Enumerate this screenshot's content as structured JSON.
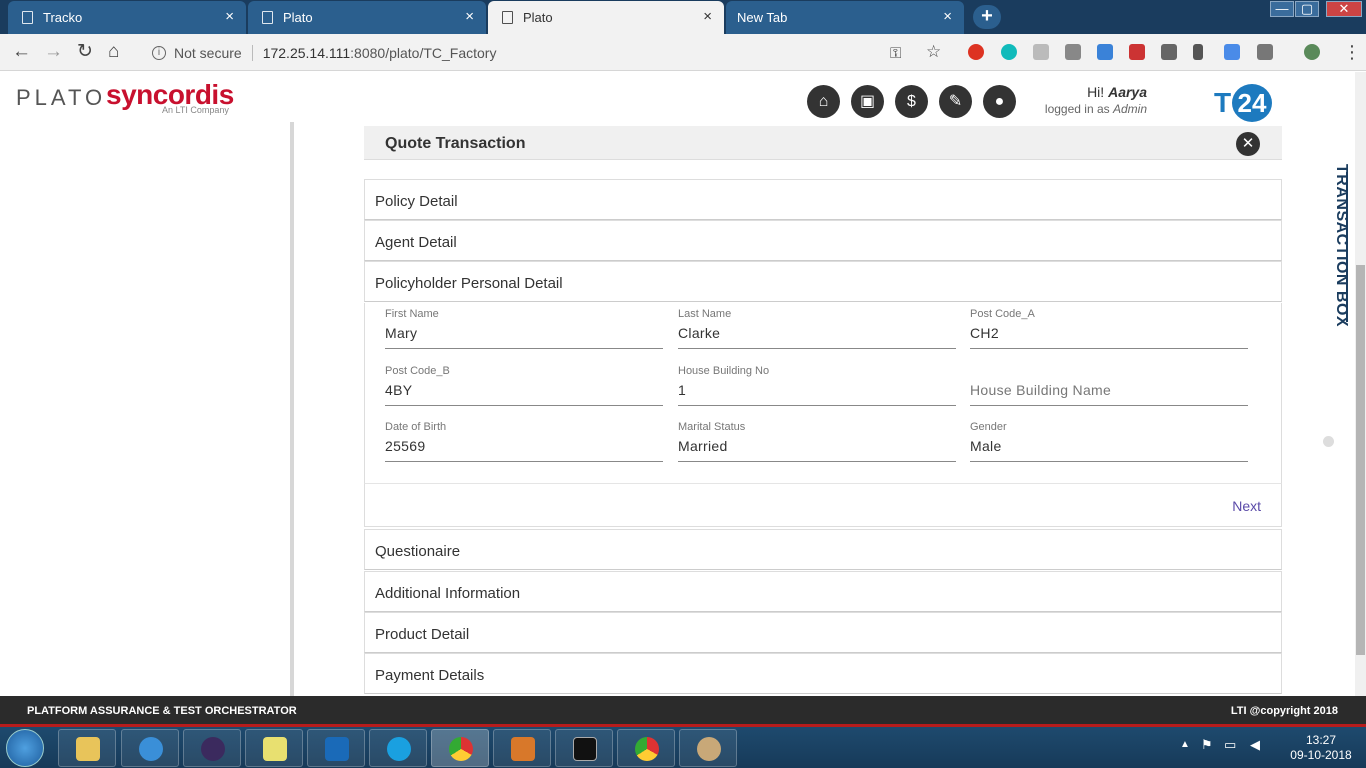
{
  "browser": {
    "tabs": [
      {
        "label": "Tracko",
        "active": false
      },
      {
        "label": "Plato",
        "active": false
      },
      {
        "label": "Plato",
        "active": true
      },
      {
        "label": "New Tab",
        "active": false
      }
    ],
    "tab_close": "×",
    "new_tab": "+",
    "security": "Not secure",
    "url_host": "172.25.14.111",
    "url_rest": ":8080/plato/TC_Factory",
    "window_controls": [
      "—",
      "▢",
      "✕"
    ]
  },
  "header": {
    "logo_plato": "PLATO",
    "logo_syncordis": "syncordis",
    "logo_tagline": "An LTI Company",
    "icons": [
      "home-icon",
      "briefcase-icon",
      "money-bag-icon",
      "wrench-icon",
      "user-icon"
    ],
    "greeting_prefix": "Hi!",
    "user_name": "Aarya",
    "logged_in_text": "logged in as",
    "role": "Admin",
    "t24_t": "T",
    "t24_num": "24"
  },
  "panel": {
    "title": "Quote Transaction",
    "close": "✕",
    "sections_top": [
      "Policy Detail",
      "Agent Detail",
      "Policyholder Personal Detail"
    ],
    "sections_bottom": [
      "Questionaire",
      "Additional Information",
      "Product Detail",
      "Payment Details"
    ],
    "next_label": "Next"
  },
  "form": {
    "first_name": {
      "label": "First Name",
      "value": "Mary"
    },
    "last_name": {
      "label": "Last Name",
      "value": "Clarke"
    },
    "post_code_a": {
      "label": "Post Code_A",
      "value": "CH2"
    },
    "post_code_b": {
      "label": "Post Code_B",
      "value": "4BY"
    },
    "house_no": {
      "label": "House Building No",
      "value": "1"
    },
    "house_name": {
      "placeholder": "House Building Name"
    },
    "dob": {
      "label": "Date of Birth",
      "value": "25569"
    },
    "marital": {
      "label": "Marital Status",
      "value": "Married"
    },
    "gender": {
      "label": "Gender",
      "value": "Male"
    }
  },
  "side": {
    "transaction_box": "TRANSACTION BOX"
  },
  "footer": {
    "left": "PLATFORM ASSURANCE & TEST ORCHESTRATOR",
    "right": "LTI @copyright 2018"
  },
  "taskbar": {
    "time": "13:27",
    "date": "09-10-2018"
  }
}
